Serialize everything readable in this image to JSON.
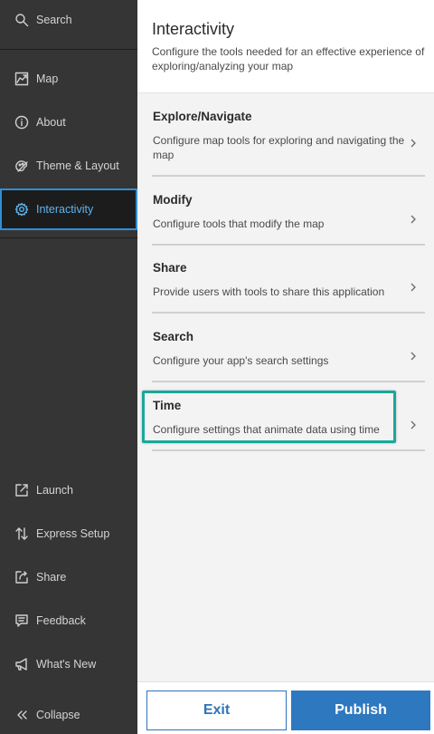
{
  "sidebar": {
    "search": {
      "label": "Search",
      "icon": "search-icon"
    },
    "items": [
      {
        "label": "Map",
        "icon": "map-icon"
      },
      {
        "label": "About",
        "icon": "info-icon"
      },
      {
        "label": "Theme & Layout",
        "icon": "palette-icon"
      },
      {
        "label": "Interactivity",
        "icon": "gear-icon",
        "active": true
      }
    ],
    "bottom_items": [
      {
        "label": "Launch",
        "icon": "launch-icon"
      },
      {
        "label": "Express Setup",
        "icon": "sort-arrows-icon"
      },
      {
        "label": "Share",
        "icon": "share-icon"
      },
      {
        "label": "Feedback",
        "icon": "feedback-icon"
      },
      {
        "label": "What's New",
        "icon": "megaphone-icon"
      },
      {
        "label": "Collapse",
        "icon": "chevrons-left-icon"
      }
    ]
  },
  "main": {
    "title": "Interactivity",
    "description": "Configure the tools needed for an effective experience of exploring/analyzing your map",
    "cards": [
      {
        "title": "Explore/Navigate",
        "description": "Configure map tools for exploring and navigating the map"
      },
      {
        "title": "Modify",
        "description": "Configure tools that modify the map"
      },
      {
        "title": "Share",
        "description": "Provide users with tools to share this application"
      },
      {
        "title": "Search",
        "description": "Configure your app's search settings"
      },
      {
        "title": "Time",
        "description": "Configure settings that animate data using time"
      }
    ]
  },
  "footer": {
    "exit_label": "Exit",
    "publish_label": "Publish"
  },
  "colors": {
    "accent": "#2e78c0",
    "highlight": "#18a89b",
    "sidebar_bg": "#353535",
    "active_text": "#5fb4f0"
  }
}
